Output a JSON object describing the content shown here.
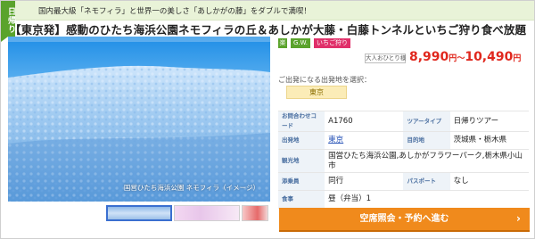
{
  "header": {
    "ribbon": "日帰り",
    "text": "国内最大級「ネモフィラ」と世界一の美しさ「あしかがの藤」をダブルで満喫！"
  },
  "title": "【東京発】感動のひたち海浜公園ネモフィラの丘＆あしかが大藤・白藤トンネルといちご狩り食べ放題",
  "photo": {
    "caption": "国営ひたち海浜公園 ネモフィラ（イメージ）"
  },
  "badges": [
    {
      "label": "楽",
      "color": "#5aa32c"
    },
    {
      "label": "G.W.",
      "color": "#5aa32c"
    },
    {
      "label": "いちご狩り",
      "color": "#e0306a"
    }
  ],
  "price": {
    "label": "大人おひとり様",
    "min": "8,990",
    "max": "10,490",
    "unit": "円",
    "separator": "〜"
  },
  "departure": {
    "prompt": "ご出発になる出発地を選択：",
    "selected": "東京"
  },
  "info": {
    "inquiry_code_label": "お問合わせコード",
    "inquiry_code": "A1760",
    "tour_type_label": "ツアータイプ",
    "tour_type": "日帰りツアー",
    "departure_label": "出発地",
    "departure": "東京",
    "destination_label": "目的地",
    "destination": "茨城県・栃木県",
    "sights_label": "観光地",
    "sights": "国営ひたち海浜公園,あしかがフラワーパーク,栃木県小山市",
    "guide_label": "添乗員",
    "guide": "同行",
    "passport_label": "パスポート",
    "passport": "なし",
    "meals_label": "食事",
    "meals": "昼（弁当）1"
  },
  "cta": {
    "label": "空席照会・予約へ進む"
  },
  "colors": {
    "accent_green": "#5aa32c",
    "price_red": "#e0281e",
    "cta_orange": "#f08a1c",
    "key_blue": "#4a6fa0"
  }
}
